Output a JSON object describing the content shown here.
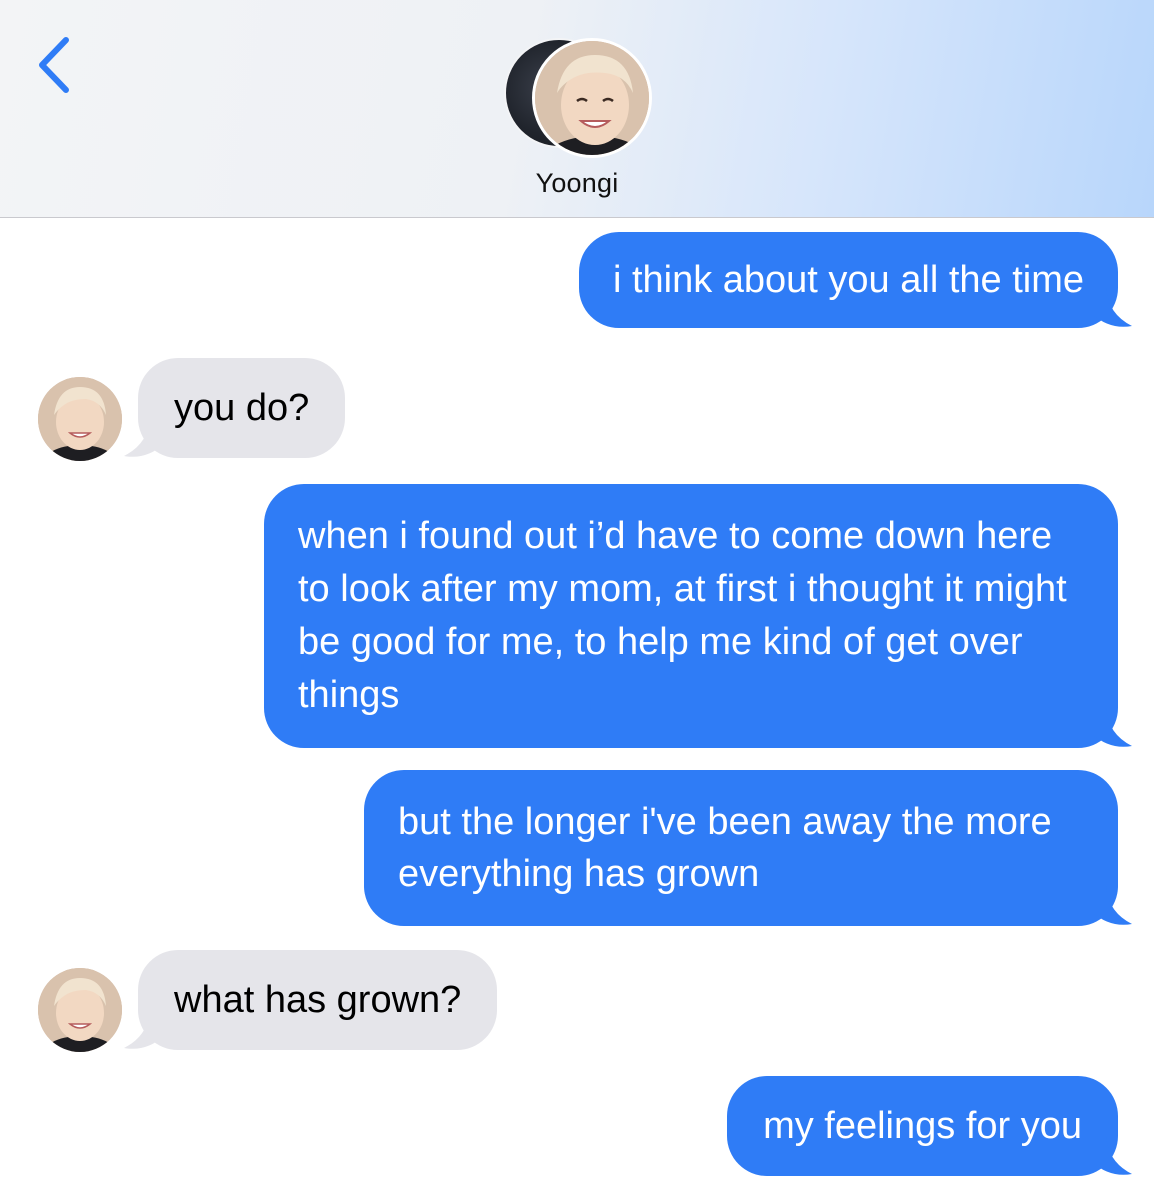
{
  "header": {
    "back_icon": "chevron-left-icon",
    "contact_name": "Yoongi",
    "accent_color": "#2f7cf6"
  },
  "messages": [
    {
      "from": "me",
      "text": "i think about you all the time"
    },
    {
      "from": "them",
      "text": "you do?"
    },
    {
      "from": "me",
      "text": "when i found out i’d have to come down here to look after my mom, at first i thought it might be good for me, to help me kind of get over things"
    },
    {
      "from": "me",
      "text": "but the longer i've been away the more everything has grown"
    },
    {
      "from": "them",
      "text": "what has grown?"
    },
    {
      "from": "me",
      "text": "my feelings for you"
    }
  ],
  "colors": {
    "outgoing_bubble": "#2f7cf6",
    "incoming_bubble": "#e5e5ea"
  }
}
